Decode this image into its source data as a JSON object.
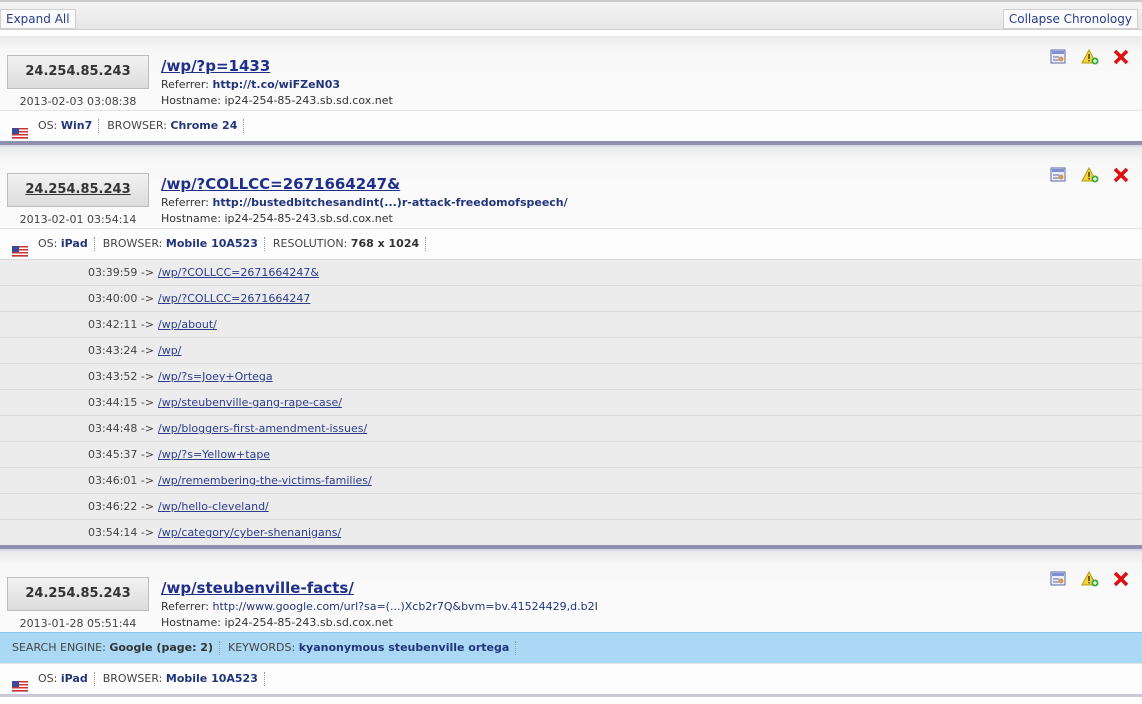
{
  "toolbar": {
    "expand_all": "Expand All",
    "collapse_chronology": "Collapse Chronology"
  },
  "visits": [
    {
      "ip": "24.254.85.243",
      "datetime": "2013-02-03 03:08:38",
      "url": "/wp/?p=1433",
      "referrer_label": "Referrer:",
      "referrer": "http://t.co/wiFZeN03",
      "hostname_label": "Hostname:",
      "hostname": "ip24-254-85-243.sb.sd.cox.net",
      "os_label": "OS:",
      "os": "Win7",
      "browser_label": "BROWSER:",
      "browser": "Chrome 24"
    },
    {
      "ip": "24.254.85.243",
      "datetime": "2013-02-01 03:54:14",
      "url": "/wp/?COLLCC=2671664247&",
      "referrer_label": "Referrer:",
      "referrer": "http://bustedbitchesandint(...)r-attack-freedomofspeech/",
      "hostname_label": "Hostname:",
      "hostname": "ip24-254-85-243.sb.sd.cox.net",
      "os_label": "OS:",
      "os": "iPad",
      "browser_label": "BROWSER:",
      "browser": "Mobile 10A523",
      "resolution_label": "RESOLUTION:",
      "resolution": "768 x 1024",
      "chronology": [
        {
          "time": "03:39:59",
          "arrow": "->",
          "path": "/wp/?COLLCC=2671664247&"
        },
        {
          "time": "03:40:00",
          "arrow": "->",
          "path": "/wp/?COLLCC=2671664247"
        },
        {
          "time": "03:42:11",
          "arrow": "->",
          "path": "/wp/about/"
        },
        {
          "time": "03:43:24",
          "arrow": "->",
          "path": "/wp/"
        },
        {
          "time": "03:43:52",
          "arrow": "->",
          "path": "/wp/?s=Joey+Ortega"
        },
        {
          "time": "03:44:15",
          "arrow": "->",
          "path": "/wp/steubenville-gang-rape-case/"
        },
        {
          "time": "03:44:48",
          "arrow": "->",
          "path": "/wp/bloggers-first-amendment-issues/"
        },
        {
          "time": "03:45:37",
          "arrow": "->",
          "path": "/wp/?s=Yellow+tape"
        },
        {
          "time": "03:46:01",
          "arrow": "->",
          "path": "/wp/remembering-the-victims-families/"
        },
        {
          "time": "03:46:22",
          "arrow": "->",
          "path": "/wp/hello-cleveland/"
        },
        {
          "time": "03:54:14",
          "arrow": "->",
          "path": "/wp/category/cyber-shenanigans/"
        }
      ]
    },
    {
      "ip": "24.254.85.243",
      "datetime": "2013-01-28 05:51:44",
      "url": "/wp/steubenville-facts/",
      "referrer_label": "Referrer:",
      "referrer": "http://www.google.com/url?sa=(...)Xcb2r7Q&bvm=bv.41524429,d.b2I",
      "hostname_label": "Hostname:",
      "hostname": "ip24-254-85-243.sb.sd.cox.net",
      "search_engine_label": "SEARCH ENGINE:",
      "search_engine": "Google (page: 2)",
      "keywords_label": "KEYWORDS:",
      "keywords": "kyanonymous steubenville ortega",
      "os_label": "OS:",
      "os": "iPad",
      "browser_label": "BROWSER:",
      "browser": "Mobile 10A523"
    }
  ],
  "icons": {
    "details": "details-icon",
    "add_warning": "warning-add-icon",
    "delete": "delete-icon",
    "flag": "us-flag-icon"
  },
  "colors": {
    "link": "#1f2f8a",
    "search_row": "#aad8f5",
    "divider": "#8f8faf"
  }
}
